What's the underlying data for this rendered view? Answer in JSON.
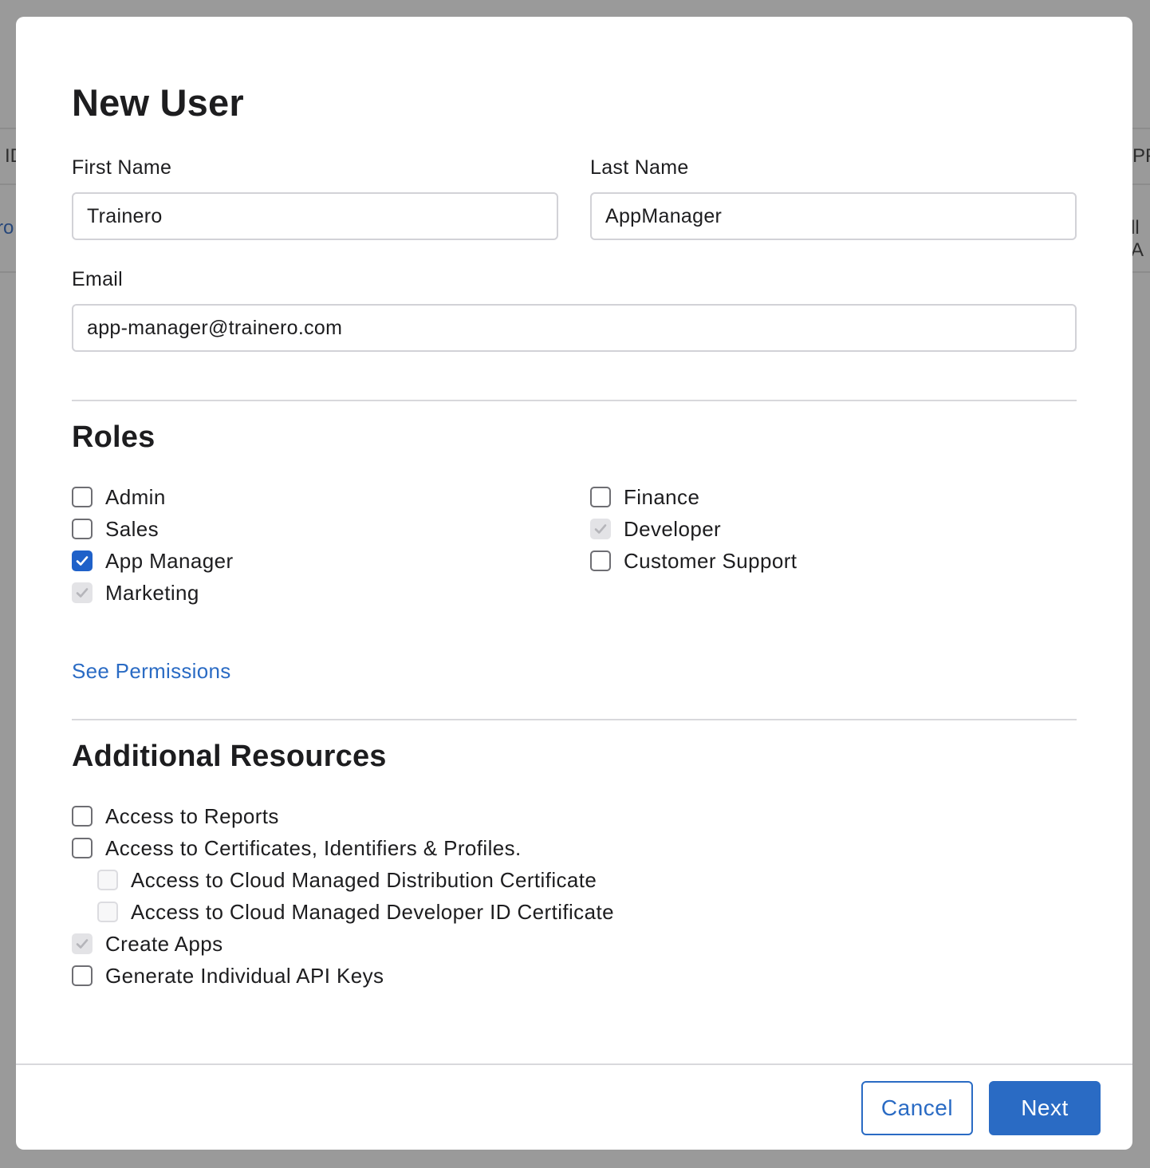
{
  "background": {
    "col_left_header": "ID",
    "col_right_header": "PP",
    "row_left_link": "ro",
    "row_right_text": "ll A"
  },
  "modal": {
    "title": "New User",
    "first_name": {
      "label": "First Name",
      "value": "Trainero"
    },
    "last_name": {
      "label": "Last Name",
      "value": "AppManager"
    },
    "email": {
      "label": "Email",
      "value": "app-manager@trainero.com"
    },
    "roles": {
      "title": "Roles",
      "left": [
        {
          "label": "Admin",
          "state": "unchecked"
        },
        {
          "label": "Sales",
          "state": "unchecked"
        },
        {
          "label": "App Manager",
          "state": "checked"
        },
        {
          "label": "Marketing",
          "state": "disabled-checked"
        }
      ],
      "right": [
        {
          "label": "Finance",
          "state": "unchecked"
        },
        {
          "label": "Developer",
          "state": "disabled-checked"
        },
        {
          "label": "Customer Support",
          "state": "unchecked"
        }
      ],
      "see_permissions": "See Permissions"
    },
    "additional": {
      "title": "Additional Resources",
      "items": [
        {
          "label": "Access to Reports",
          "state": "unchecked"
        },
        {
          "label": "Access to Certificates, Identifiers & Profiles.",
          "state": "unchecked"
        },
        {
          "label": "Access to Cloud Managed Distribution Certificate",
          "state": "disabled-unchecked"
        },
        {
          "label": "Access to Cloud Managed Developer ID Certificate",
          "state": "disabled-unchecked"
        },
        {
          "label": "Create Apps",
          "state": "disabled-checked"
        },
        {
          "label": "Generate Individual API Keys",
          "state": "unchecked"
        }
      ]
    },
    "footer": {
      "cancel_label": "Cancel",
      "next_label": "Next"
    }
  },
  "colors": {
    "accent": "#2a6bc4",
    "checkbox_checked": "#1f61c9",
    "overlay": "#9a9a9a"
  }
}
